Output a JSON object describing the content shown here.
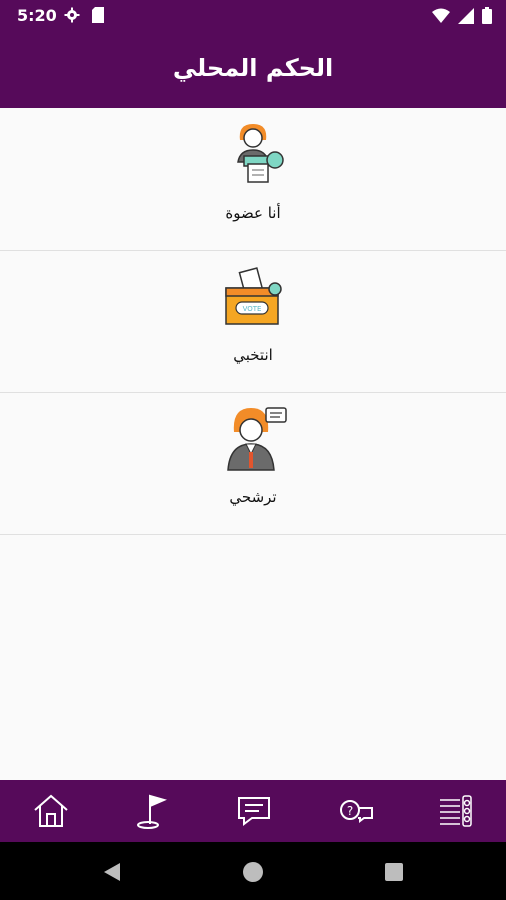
{
  "status_bar": {
    "time": "5:20",
    "left_icons": [
      "gear-icon",
      "sd-card-icon"
    ],
    "right_icons": [
      "wifi-icon",
      "signal-icon",
      "battery-icon"
    ]
  },
  "app_bar": {
    "title": "الحكم المحلي"
  },
  "menu": {
    "items": [
      {
        "label": "أنا عضوة",
        "icon": "member-speaker-icon"
      },
      {
        "label": "انتخبي",
        "icon": "vote-box-icon"
      },
      {
        "label": "ترشحي",
        "icon": "candidate-woman-icon"
      }
    ]
  },
  "bottom_nav": {
    "items": [
      "home-icon",
      "flag-icon",
      "message-icon",
      "faq-chat-icon",
      "schedule-icon"
    ]
  },
  "system_nav": [
    "back-icon",
    "home-circle-icon",
    "recents-icon"
  ],
  "colors": {
    "primary": "#560a5a",
    "background": "#fafafa",
    "divider": "#e0e0e0",
    "accent_orange": "#f28c28",
    "accent_teal": "#7fd7c4"
  }
}
